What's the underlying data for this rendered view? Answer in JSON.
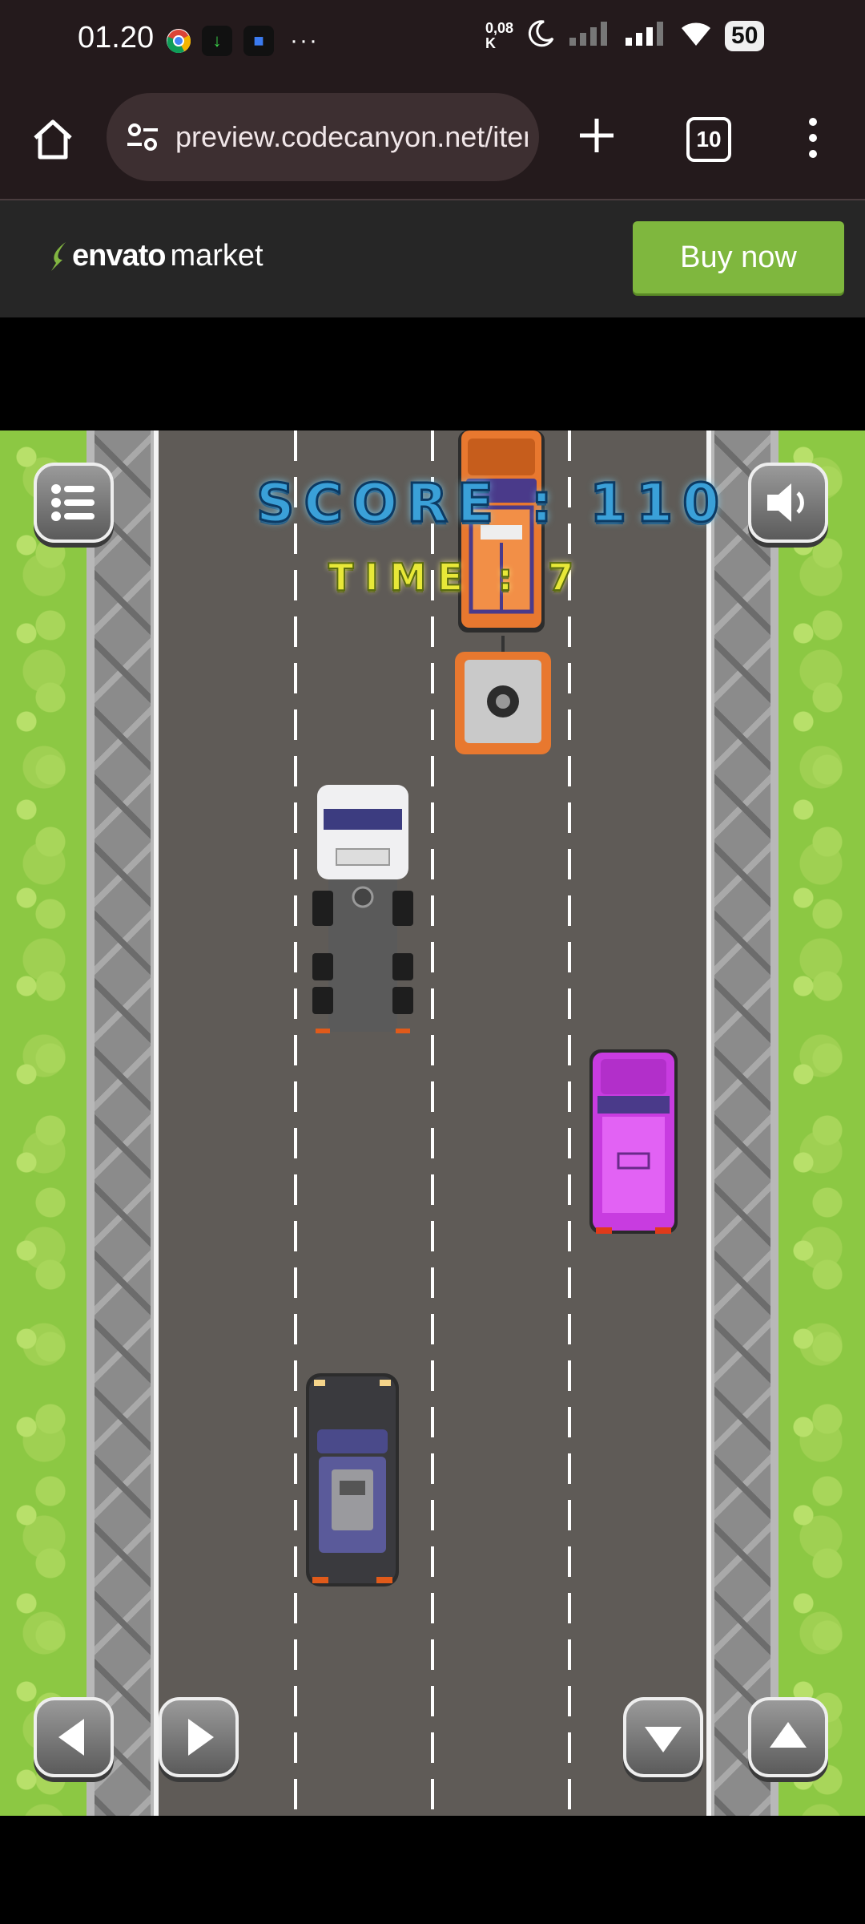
{
  "status_bar": {
    "time": "01.20",
    "net_speed_value": "0,08",
    "net_speed_unit": "K",
    "battery": "50"
  },
  "browser": {
    "url": "preview.codecanyon.net/item",
    "tab_count": "10"
  },
  "envato": {
    "logo_word": "envato",
    "logo_market": "market",
    "buy_button": "Buy now",
    "brand_color": "#7fb73e"
  },
  "game": {
    "score_label": "SCORE : 110",
    "time_label": "TIME : 7",
    "controls": [
      "menu-icon",
      "sound-icon",
      "left-arrow-icon",
      "right-arrow-icon",
      "down-arrow-icon",
      "up-arrow-icon"
    ],
    "vehicles": [
      {
        "name": "orange-pickup-truck",
        "color": "#e8782f"
      },
      {
        "name": "orange-trailer",
        "color": "#e8782f"
      },
      {
        "name": "white-semi-truck",
        "color": "#e6e6ea"
      },
      {
        "name": "purple-car",
        "color": "#c83ce0"
      },
      {
        "name": "player-black-car",
        "color": "#3a3a44"
      }
    ]
  }
}
